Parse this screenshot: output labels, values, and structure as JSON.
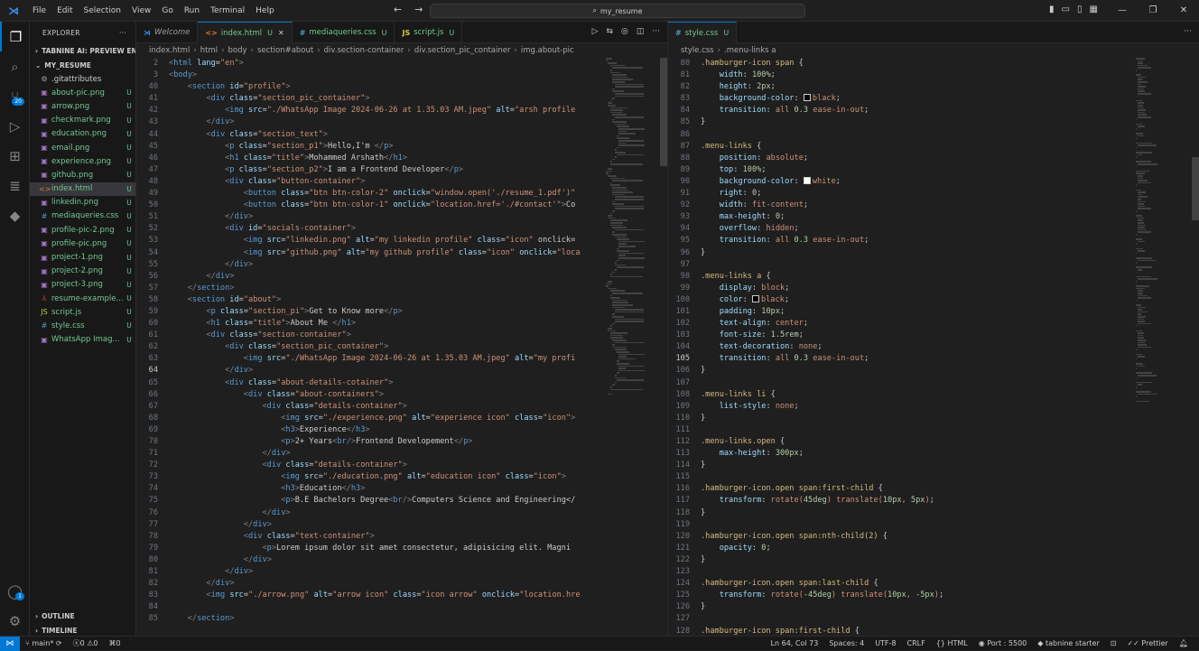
{
  "titlebar": {
    "menus": [
      "File",
      "Edit",
      "Selection",
      "View",
      "Go",
      "Run",
      "Terminal",
      "Help"
    ],
    "search": "my_resume"
  },
  "sidebar": {
    "header": "EXPLORER",
    "extension_section": "TABNINE AI: PREVIEW EN...",
    "project": "MY_RESUME",
    "files": [
      {
        "name": ".gitattributes",
        "status": "",
        "icon": "gear-icon",
        "color": "#cccccc"
      },
      {
        "name": "about-pic.png",
        "status": "U",
        "icon": "image-icon",
        "color": "#73c991"
      },
      {
        "name": "arrow.png",
        "status": "U",
        "icon": "image-icon",
        "color": "#73c991"
      },
      {
        "name": "checkmark.png",
        "status": "U",
        "icon": "image-icon",
        "color": "#73c991"
      },
      {
        "name": "education.png",
        "status": "U",
        "icon": "image-icon",
        "color": "#73c991"
      },
      {
        "name": "email.png",
        "status": "U",
        "icon": "image-icon",
        "color": "#73c991"
      },
      {
        "name": "experience.png",
        "status": "U",
        "icon": "image-icon",
        "color": "#73c991"
      },
      {
        "name": "github.png",
        "status": "U",
        "icon": "image-icon",
        "color": "#73c991"
      },
      {
        "name": "index.html",
        "status": "U",
        "icon": "html-icon",
        "color": "#73c991"
      },
      {
        "name": "linkedin.png",
        "status": "U",
        "icon": "image-icon",
        "color": "#73c991"
      },
      {
        "name": "mediaqueries.css",
        "status": "U",
        "icon": "css-icon",
        "color": "#73c991"
      },
      {
        "name": "profile-pic-2.png",
        "status": "U",
        "icon": "image-icon",
        "color": "#73c991"
      },
      {
        "name": "profile-pic.png",
        "status": "U",
        "icon": "image-icon",
        "color": "#73c991"
      },
      {
        "name": "project-1.png",
        "status": "U",
        "icon": "image-icon",
        "color": "#73c991"
      },
      {
        "name": "project-2.png",
        "status": "U",
        "icon": "image-icon",
        "color": "#73c991"
      },
      {
        "name": "project-3.png",
        "status": "U",
        "icon": "image-icon",
        "color": "#73c991"
      },
      {
        "name": "resume-example...",
        "status": "U",
        "icon": "pdf-icon",
        "color": "#73c991"
      },
      {
        "name": "script.js",
        "status": "U",
        "icon": "js-icon",
        "color": "#73c991"
      },
      {
        "name": "style.css",
        "status": "U",
        "icon": "css-icon",
        "color": "#73c991"
      },
      {
        "name": "WhatsApp Imag...",
        "status": "U",
        "icon": "image-icon",
        "color": "#73c991"
      }
    ],
    "outline": "OUTLINE",
    "timeline": "TIMELINE"
  },
  "editor1": {
    "tabs": [
      {
        "label": "Welcome",
        "icon": "vscode-icon",
        "status": ""
      },
      {
        "label": "index.html",
        "icon": "html-icon",
        "status": "U"
      },
      {
        "label": "mediaqueries.css",
        "icon": "css-icon",
        "status": "U"
      },
      {
        "label": "script.js",
        "icon": "js-icon",
        "status": "U"
      }
    ],
    "breadcrumb": [
      "index.html",
      "html",
      "body",
      "section#about",
      "div.section-container",
      "div.section_pic_container",
      "img.about-pic"
    ],
    "lines": [
      [
        "2",
        "<html lang=\"en\">"
      ],
      [
        "3",
        "<body>"
      ],
      [
        "40",
        "    <section id=\"profile\">"
      ],
      [
        "41",
        "        <div class=\"section_pic_container\">"
      ],
      [
        "42",
        "            <img src=\"./WhatsApp Image 2024-06-26 at 1.35.03 AM.jpeg\" alt=\"arsh profile"
      ],
      [
        "43",
        "        </div>"
      ],
      [
        "44",
        "        <div class=\"section_text\">"
      ],
      [
        "45",
        "            <p class=\"section_p1\">Hello,I'm </p>"
      ],
      [
        "46",
        "            <h1 class=\"title\">Mohammed Arshath</h1>"
      ],
      [
        "47",
        "            <p class=\"section_p2\">I am a Frontend Developer</p>"
      ],
      [
        "48",
        "            <div class=\"button-container\">"
      ],
      [
        "49",
        "                <button class=\"btn btn-color-2\" onclick=\"window.open('./resume_1.pdf')\""
      ],
      [
        "50",
        "                <button class=\"btn btn-color-1\" onclick=\"location.href='./#contact'\">Co"
      ],
      [
        "51",
        "            </div>"
      ],
      [
        "52",
        "            <div id=\"socials-container\">"
      ],
      [
        "53",
        "                <img src=\"linkedin.png\" alt=\"my linkedin profile\" class=\"icon\" onclick="
      ],
      [
        "54",
        "                <img src=\"github.png\" alt=\"my github profile\" class=\"icon\" onclick=\"loca"
      ],
      [
        "55",
        "            </div>"
      ],
      [
        "56",
        "        </div>"
      ],
      [
        "57",
        "    </section>"
      ],
      [
        "58",
        "    <section id=\"about\">"
      ],
      [
        "59",
        "        <p class=\"section_pi\">Get to Know more</p>"
      ],
      [
        "60",
        "        <h1 class=\"title\">About Me </h1>"
      ],
      [
        "61",
        "        <div class=\"section-container\">"
      ],
      [
        "62",
        "            <div class=\"section_pic_container\">"
      ],
      [
        "63",
        "                <img src=\"./WhatsApp Image 2024-06-26 at 1.35.03 AM.jpeg\" alt=\"my profi"
      ],
      [
        "64",
        "            </div>"
      ],
      [
        "65",
        "            <div class=\"about-details-cotainer\">"
      ],
      [
        "66",
        "                <div class=\"about-containers\">"
      ],
      [
        "67",
        "                    <div class=\"details-container\">"
      ],
      [
        "68",
        "                        <img src=\"./experience.png\" alt=\"experience icon\" class=\"icon\">"
      ],
      [
        "69",
        "                        <h3>Experience</h3>"
      ],
      [
        "70",
        "                        <p>2+ Years<br/>Frontend Developement</p>"
      ],
      [
        "71",
        "                    </div>"
      ],
      [
        "72",
        "                    <div class=\"details-container\">"
      ],
      [
        "73",
        "                        <img src=\"./education.png\" alt=\"education icon\" class=\"icon\">"
      ],
      [
        "74",
        "                        <h3>Education</h3>"
      ],
      [
        "75",
        "                        <p>B.E Bachelors Degree<br/>Computers Science and Engineering</"
      ],
      [
        "76",
        "                    </div>"
      ],
      [
        "77",
        "                </div>"
      ],
      [
        "78",
        "                <div class=\"text-container\">"
      ],
      [
        "79",
        "                    <p>Lorem ipsum dolor sit amet consectetur, adipisicing elit. Magni"
      ],
      [
        "80",
        "                </div>"
      ],
      [
        "81",
        "            </div>"
      ],
      [
        "82",
        "        </div>"
      ],
      [
        "83",
        "        <img src=\"./arrow.png\" alt=\"arrow icon\" class=\"icon arrow\" onclick=\"location.hre"
      ],
      [
        "84",
        ""
      ],
      [
        "85",
        "    </section>"
      ]
    ]
  },
  "editor2": {
    "tabs": [
      {
        "label": "style.css",
        "icon": "css-icon",
        "status": "U"
      }
    ],
    "breadcrumb": [
      "style.css",
      ".menu-links a"
    ],
    "lines": [
      [
        "80",
        ".hamburger-icon span {"
      ],
      [
        "81",
        "    width: 100%;"
      ],
      [
        "82",
        "    height: 2px;"
      ],
      [
        "83",
        "    background-color: black;"
      ],
      [
        "84",
        "    transition: all 0.3 ease-in-out;"
      ],
      [
        "85",
        "}"
      ],
      [
        "86",
        ""
      ],
      [
        "87",
        ".menu-links {"
      ],
      [
        "88",
        "    position: absolute;"
      ],
      [
        "89",
        "    top: 100%;"
      ],
      [
        "90",
        "    background-color: white;"
      ],
      [
        "91",
        "    right: 0;"
      ],
      [
        "92",
        "    width: fit-content;"
      ],
      [
        "93",
        "    max-height: 0;"
      ],
      [
        "94",
        "    overflow: hidden;"
      ],
      [
        "95",
        "    transition: all 0.3 ease-in-out;"
      ],
      [
        "96",
        "}"
      ],
      [
        "97",
        ""
      ],
      [
        "98",
        ".menu-links a {"
      ],
      [
        "99",
        "    display: block;"
      ],
      [
        "100",
        "    color: black;"
      ],
      [
        "101",
        "    padding: 10px;"
      ],
      [
        "102",
        "    text-align: center;"
      ],
      [
        "103",
        "    font-size: 1.5rem;"
      ],
      [
        "104",
        "    text-decoration: none;"
      ],
      [
        "105",
        "    transition: all 0.3 ease-in-out;"
      ],
      [
        "106",
        "}"
      ],
      [
        "107",
        ""
      ],
      [
        "108",
        ".menu-links li {"
      ],
      [
        "109",
        "    list-style: none;"
      ],
      [
        "110",
        "}"
      ],
      [
        "111",
        ""
      ],
      [
        "112",
        ".menu-links.open {"
      ],
      [
        "113",
        "    max-height: 300px;"
      ],
      [
        "114",
        "}"
      ],
      [
        "115",
        ""
      ],
      [
        "116",
        ".hamburger-icon.open span:first-child {"
      ],
      [
        "117",
        "    transform: rotate(45deg) translate(10px, 5px);"
      ],
      [
        "118",
        "}"
      ],
      [
        "119",
        ""
      ],
      [
        "120",
        ".hamburger-icon.open span:nth-child(2) {"
      ],
      [
        "121",
        "    opacity: 0;"
      ],
      [
        "122",
        "}"
      ],
      [
        "123",
        ""
      ],
      [
        "124",
        ".hamburger-icon.open span:last-child {"
      ],
      [
        "125",
        "    transform: rotate(-45deg) translate(10px, -5px);"
      ],
      [
        "126",
        "}"
      ],
      [
        "127",
        ""
      ],
      [
        "128",
        ".hamburger-icon span:first-child {"
      ]
    ]
  },
  "statusbar": {
    "branch": "main*",
    "errors": "0",
    "warnings": "0",
    "ports_count": "0",
    "cursor": "Ln 64, Col 73",
    "spaces": "Spaces: 4",
    "encoding": "UTF-8",
    "eol": "CRLF",
    "language": "HTML",
    "port": "Port : 5500",
    "tabnine": "tabnine starter",
    "prettier": "Prettier"
  },
  "colors": {
    "accent": "#0078d4",
    "untracked": "#73c991"
  }
}
